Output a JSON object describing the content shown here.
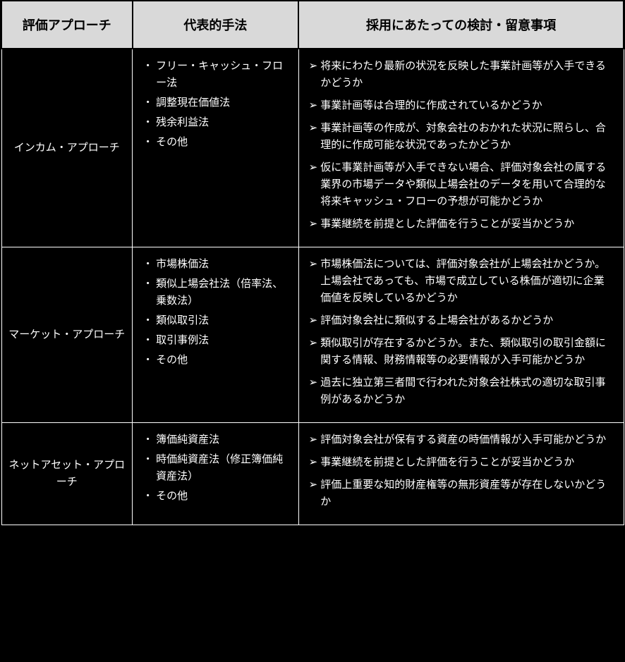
{
  "headers": {
    "col1": "評価アプローチ",
    "col2": "代表的手法",
    "col3": "採用にあたっての検討・留意事項"
  },
  "rows": [
    {
      "approach": "インカム・アプローチ",
      "methods": [
        "フリー・キャッシュ・フロー法",
        "調整現在価値法",
        "残余利益法",
        "その他"
      ],
      "considerations": [
        "将来にわたり最新の状況を反映した事業計画等が入手できるかどうか",
        "事業計画等は合理的に作成されているかどうか",
        "事業計画等の作成が、対象会社のおかれた状況に照らし、合理的に作成可能な状況であったかどうか",
        "仮に事業計画等が入手できない場合、評価対象会社の属する業界の市場データや類似上場会社のデータを用いて合理的な将来キャッシュ・フローの予想が可能かどうか",
        "事業継続を前提とした評価を行うことが妥当かどうか"
      ]
    },
    {
      "approach": "マーケット・アプローチ",
      "methods": [
        "市場株価法",
        "類似上場会社法（倍率法、乗数法）",
        "類似取引法",
        "取引事例法",
        "その他"
      ],
      "considerations": [
        "市場株価法については、評価対象会社が上場会社かどうか。上場会社であっても、市場で成立している株価が適切に企業価値を反映しているかどうか",
        "評価対象会社に類似する上場会社があるかどうか",
        "類似取引が存在するかどうか。また、類似取引の取引金額に関する情報、財務情報等の必要情報が入手可能かどうか",
        "過去に独立第三者間で行われた対象会社株式の適切な取引事例があるかどうか"
      ]
    },
    {
      "approach": "ネットアセット・アプローチ",
      "methods": [
        "簿価純資産法",
        "時価純資産法（修正簿価純資産法）",
        "その他"
      ],
      "considerations": [
        "評価対象会社が保有する資産の時価情報が入手可能かどうか",
        "事業継続を前提とした評価を行うことが妥当かどうか",
        "評価上重要な知的財産権等の無形資産等が存在しないかどうか"
      ]
    }
  ],
  "bullet_marker": "・",
  "consideration_marker": "➢"
}
